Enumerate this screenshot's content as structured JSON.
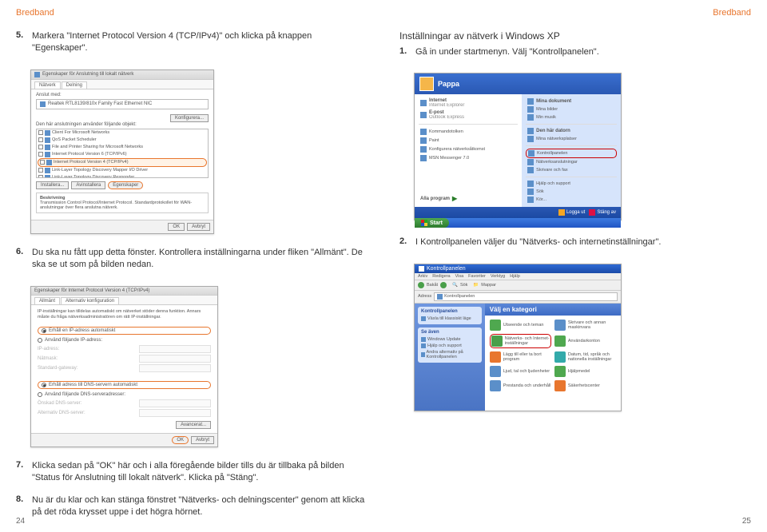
{
  "header": {
    "left": "Bredband",
    "right": "Bredband"
  },
  "left": {
    "step5": {
      "num": "5.",
      "text": "Markera \"Internet Protocol Version 4 (TCP/IPv4)\" och klicka på knappen \"Egenskaper\"."
    },
    "step6": {
      "num": "6.",
      "text": "Du ska nu fått upp detta fönster. Kontrollera inställningarna under fliken \"Allmänt\". De ska se ut som på bilden nedan."
    },
    "step7": {
      "num": "7.",
      "text": "Klicka sedan på \"OK\" här och i alla föregående bilder tills du är tillbaka på bilden \"Status för Anslutning till lokalt nätverk\". Klicka på \"Stäng\"."
    },
    "step8": {
      "num": "8.",
      "text": "Nu är du klar och kan stänga fönstret \"Nätverks- och delningscenter\" genom att klicka på det röda krysset uppe i det högra hörnet."
    },
    "pagenum": "24"
  },
  "right": {
    "title": "Inställningar av nätverk i Windows XP",
    "step1": {
      "num": "1.",
      "text": "Gå in under startmenyn. Välj \"Kontrollpanelen\"."
    },
    "step2": {
      "num": "2.",
      "text": "I Kontrollpanelen väljer du \"Nätverks- och internetinställningar\"."
    },
    "pagenum": "25"
  },
  "shot5": {
    "title": "Egenskaper för Anslutning till lokalt nätverk",
    "tabs": [
      "Nätverk",
      "Delning"
    ],
    "connectLabel": "Anslut med:",
    "adapter": "Realtek RTL8139/810x Family Fast Ethernet NIC",
    "configure": "Konfigurera...",
    "listLabel": "Den här anslutningen använder följande objekt:",
    "items": [
      "Client For Microsoft Networks",
      "QoS Packet Scheduler",
      "File and Printer Sharing for Microsoft Networks",
      "Internet Protocol Version 6 (TCP/IPv6)",
      "Internet Protocol Version 4 (TCP/IPv4)",
      "Link-Layer Topology Discovery Mapper I/O Driver",
      "Link-Layer Topology Discovery Responder"
    ],
    "install": "Installera...",
    "uninstall": "Avinstallera",
    "properties": "Egenskaper",
    "descLabel": "Beskrivning",
    "desc": "Transmission Control Protocol/Internet Protocol. Standardprotokollet för WAN-anslutningar över flera anslutna nätverk.",
    "ok": "OK",
    "cancel": "Avbryt"
  },
  "shot6": {
    "title": "Egenskaper för Internet Protocol Version 4 (TCP/IPv4)",
    "tabs": [
      "Allmänt",
      "Alternativ konfiguration"
    ],
    "desc": "IP-inställningar kan tilldelas automatiskt om nätverket stöder denna funktion. Annars måste du fråga nätverksadministratören om rätt IP-inställningar.",
    "r1": "Erhåll en IP-adress automatiskt",
    "r2": "Använd följande IP-adress:",
    "rows1": [
      "IP-adress:",
      "Nätmask:",
      "Standard-gateway:"
    ],
    "r3": "Erhåll adress till DNS-servern automatiskt",
    "r4": "Använd följande DNS-serveradresser:",
    "rows2": [
      "Önskad DNS-server:",
      "Alternativ DNS-server:"
    ],
    "advanced": "Avancerat...",
    "ok": "OK",
    "cancel": "Avbryt"
  },
  "xp": {
    "user": "Pappa",
    "leftItems": [
      {
        "t": "Internet",
        "sub": "Internet Explorer"
      },
      {
        "t": "E-post",
        "sub": "Outlook Express"
      }
    ],
    "leftItems2": [
      "Kommandotolken",
      "Paint",
      "Konfigurera nätverksåtkomst",
      "MSN Messenger 7.0"
    ],
    "allPrograms": "Alla program",
    "rightItems": [
      "Mina dokument",
      "Mina bilder",
      "Min musik",
      "Den här datorn",
      "Mina nätverksplatser",
      "Kontrollpanelen",
      "Nätverksanslutningar",
      "Skrivare och fax",
      "Hjälp och support",
      "Sök",
      "Kör..."
    ],
    "logoff": "Logga ut",
    "shutdown": "Stäng av",
    "start": "Start"
  },
  "cp": {
    "title": "Kontrollpanelen",
    "menus": [
      "Arkiv",
      "Redigera",
      "Visa",
      "Favoriter",
      "Verktyg",
      "Hjälp"
    ],
    "back": "Bakåt",
    "search": "Sök",
    "folders": "Mappar",
    "addressLabel": "Adress",
    "address": "Kontrollpanelen",
    "side1": {
      "h": "Kontrollpanelen",
      "i": "Växla till klassiskt läge"
    },
    "side2": {
      "h": "Se även",
      "i": [
        "Windows Update",
        "Hjälp och support",
        "Andra alternativ på Kontrollpanelen"
      ]
    },
    "catHeader": "Välj en kategori",
    "cats": [
      "Utseende och teman",
      "Skrivare och annan maskinvara",
      "Nätverks- och Internet-inställningar",
      "Användarkonton",
      "Lägg till eller ta bort program",
      "Datum, tid, språk och nationella inställningar",
      "Ljud, tal och ljudenheter",
      "Hjälpmedel",
      "Prestanda och underhåll",
      "Säkerhetscenter"
    ]
  }
}
